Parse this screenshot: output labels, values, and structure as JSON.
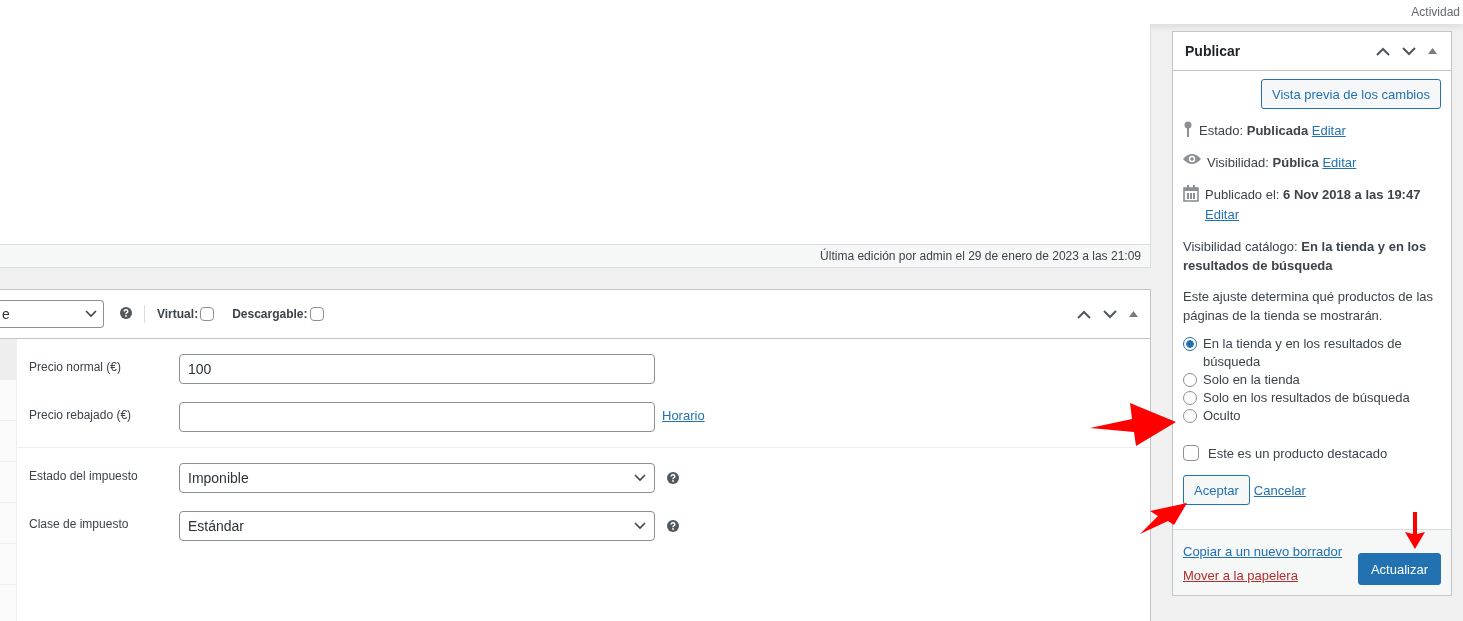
{
  "top_bar": {
    "activity": "Actividad"
  },
  "editor": {
    "last_edit": "Última edición por admin el 29 de enero de 2023 a las 21:09"
  },
  "product_data": {
    "type_select": "e",
    "options": [
      {
        "label": "Virtual:",
        "checked": false
      },
      {
        "label": "Descargable:",
        "checked": false
      }
    ],
    "groups": [
      [
        {
          "kind": "input",
          "label": "Precio normal (€)",
          "value": "100"
        },
        {
          "kind": "input",
          "label": "Precio rebajado (€)",
          "link": "Horario"
        }
      ],
      [
        {
          "kind": "select",
          "label": "Estado del impuesto",
          "value": "Imponible",
          "help": true
        },
        {
          "kind": "select",
          "label": "Clase de impuesto",
          "value": "Estándar",
          "help": true
        }
      ]
    ]
  },
  "publish": {
    "title": "Publicar",
    "preview_button": "Vista previa de los cambios",
    "meta": [
      {
        "kind": "status",
        "label": "Estado:",
        "value": "Publicada",
        "link": "Editar"
      },
      {
        "kind": "visibility",
        "label": "Visibilidad:",
        "value": "Pública",
        "link": "Editar"
      },
      {
        "kind": "date",
        "label": "Publicado el:",
        "value": "6 Nov 2018 a las 19:47",
        "link": "Editar"
      }
    ],
    "catalog_visibility": {
      "label": "Visibilidad catálogo:",
      "value": "En la tienda y en los resultados de búsqueda"
    },
    "description": "Este ajuste determina qué productos de las páginas de la tienda se mostrarán.",
    "choices": [
      {
        "label": "En la tienda y en los resultados de búsqueda",
        "selected": true
      },
      {
        "label": "Solo en la tienda",
        "selected": false
      },
      {
        "label": "Solo en los resultados de búsqueda",
        "selected": false
      },
      {
        "label": "Oculto",
        "selected": false
      }
    ],
    "featured": {
      "label": "Este es un producto destacado",
      "checked": false
    },
    "ok_button": "Aceptar",
    "cancel_link": "Cancelar",
    "copy_link": "Copiar a un nuevo borrador",
    "trash_link": "Mover a la papelera",
    "update_button": "Actualizar"
  }
}
